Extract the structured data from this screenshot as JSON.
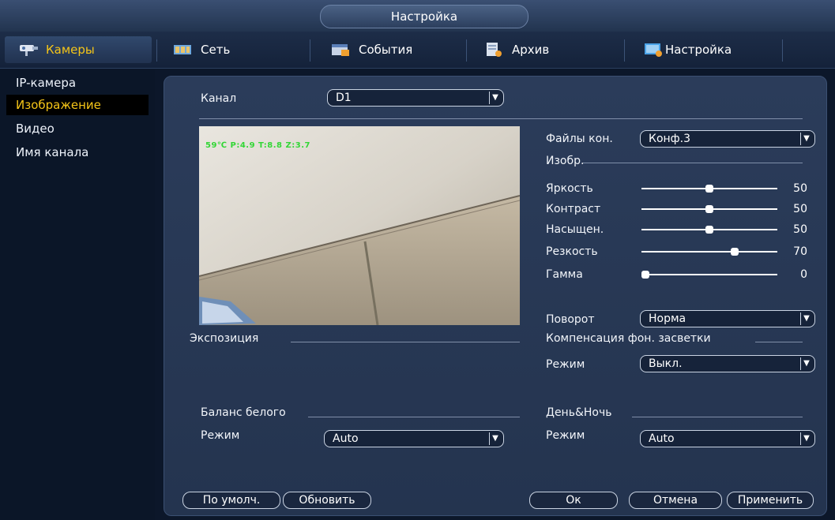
{
  "window": {
    "title": "Настройка"
  },
  "tabs": [
    {
      "label": "Камеры",
      "icon": "camera-icon",
      "active": true
    },
    {
      "label": "Сеть",
      "icon": "network-icon",
      "active": false
    },
    {
      "label": "События",
      "icon": "events-icon",
      "active": false
    },
    {
      "label": "Архив",
      "icon": "archive-icon",
      "active": false
    },
    {
      "label": "Настройка",
      "icon": "settings-icon",
      "active": false
    }
  ],
  "sidebar": {
    "items": [
      {
        "label": "IP-камера",
        "active": false
      },
      {
        "label": "Изображение",
        "active": true
      },
      {
        "label": "Видео",
        "active": false
      },
      {
        "label": "Имя канала",
        "active": false
      }
    ]
  },
  "channel": {
    "label": "Канал",
    "value": "D1"
  },
  "preview": {
    "osd": "59℃ P:4.9 T:8.8 Z:3.7"
  },
  "config_files": {
    "label": "Файлы кон.",
    "value": "Конф.3"
  },
  "image_section": {
    "label": "Изобр."
  },
  "sliders": [
    {
      "label": "Яркость",
      "value": 50
    },
    {
      "label": "Контраст",
      "value": 50
    },
    {
      "label": "Насыщен.",
      "value": 50
    },
    {
      "label": "Резкость",
      "value": 70
    },
    {
      "label": "Гамма",
      "value": 0
    }
  ],
  "rotation": {
    "label": "Поворот",
    "value": "Норма"
  },
  "exposure": {
    "label": "Экспозиция"
  },
  "backlight": {
    "label": "Компенсация фон. засветки",
    "mode_label": "Режим",
    "mode_value": "Выкл."
  },
  "white_balance": {
    "label": "Баланс белого",
    "mode_label": "Режим",
    "mode_value": "Auto"
  },
  "day_night": {
    "label": "День&Ночь",
    "mode_label": "Режим",
    "mode_value": "Auto"
  },
  "buttons": {
    "default": "По умолч.",
    "refresh": "Обновить",
    "ok": "Ок",
    "cancel": "Отмена",
    "apply": "Применить"
  },
  "colors": {
    "accent": "#f5c518",
    "panel": "#2b3c5a",
    "osd": "#32d635"
  }
}
